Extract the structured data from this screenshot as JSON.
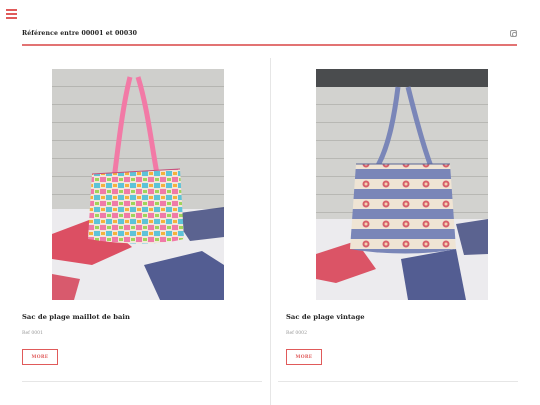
{
  "header": {
    "title": "Référence entre 00001 et 00030",
    "menu_icon": "hamburger-menu-icon",
    "social_icon": "instagram-icon",
    "accent_color": "#e05a5a"
  },
  "products": [
    {
      "title": "Sac de plage maillot de bain",
      "ref": "Ref 0001",
      "button_label": "MORE",
      "image": "photo of a colorful patterned tote bag on a bed"
    },
    {
      "title": "Sac de plage vintage",
      "ref": "Ref 0002",
      "button_label": "MORE",
      "image": "photo of a blue striped floral tote bag on a bed"
    }
  ]
}
